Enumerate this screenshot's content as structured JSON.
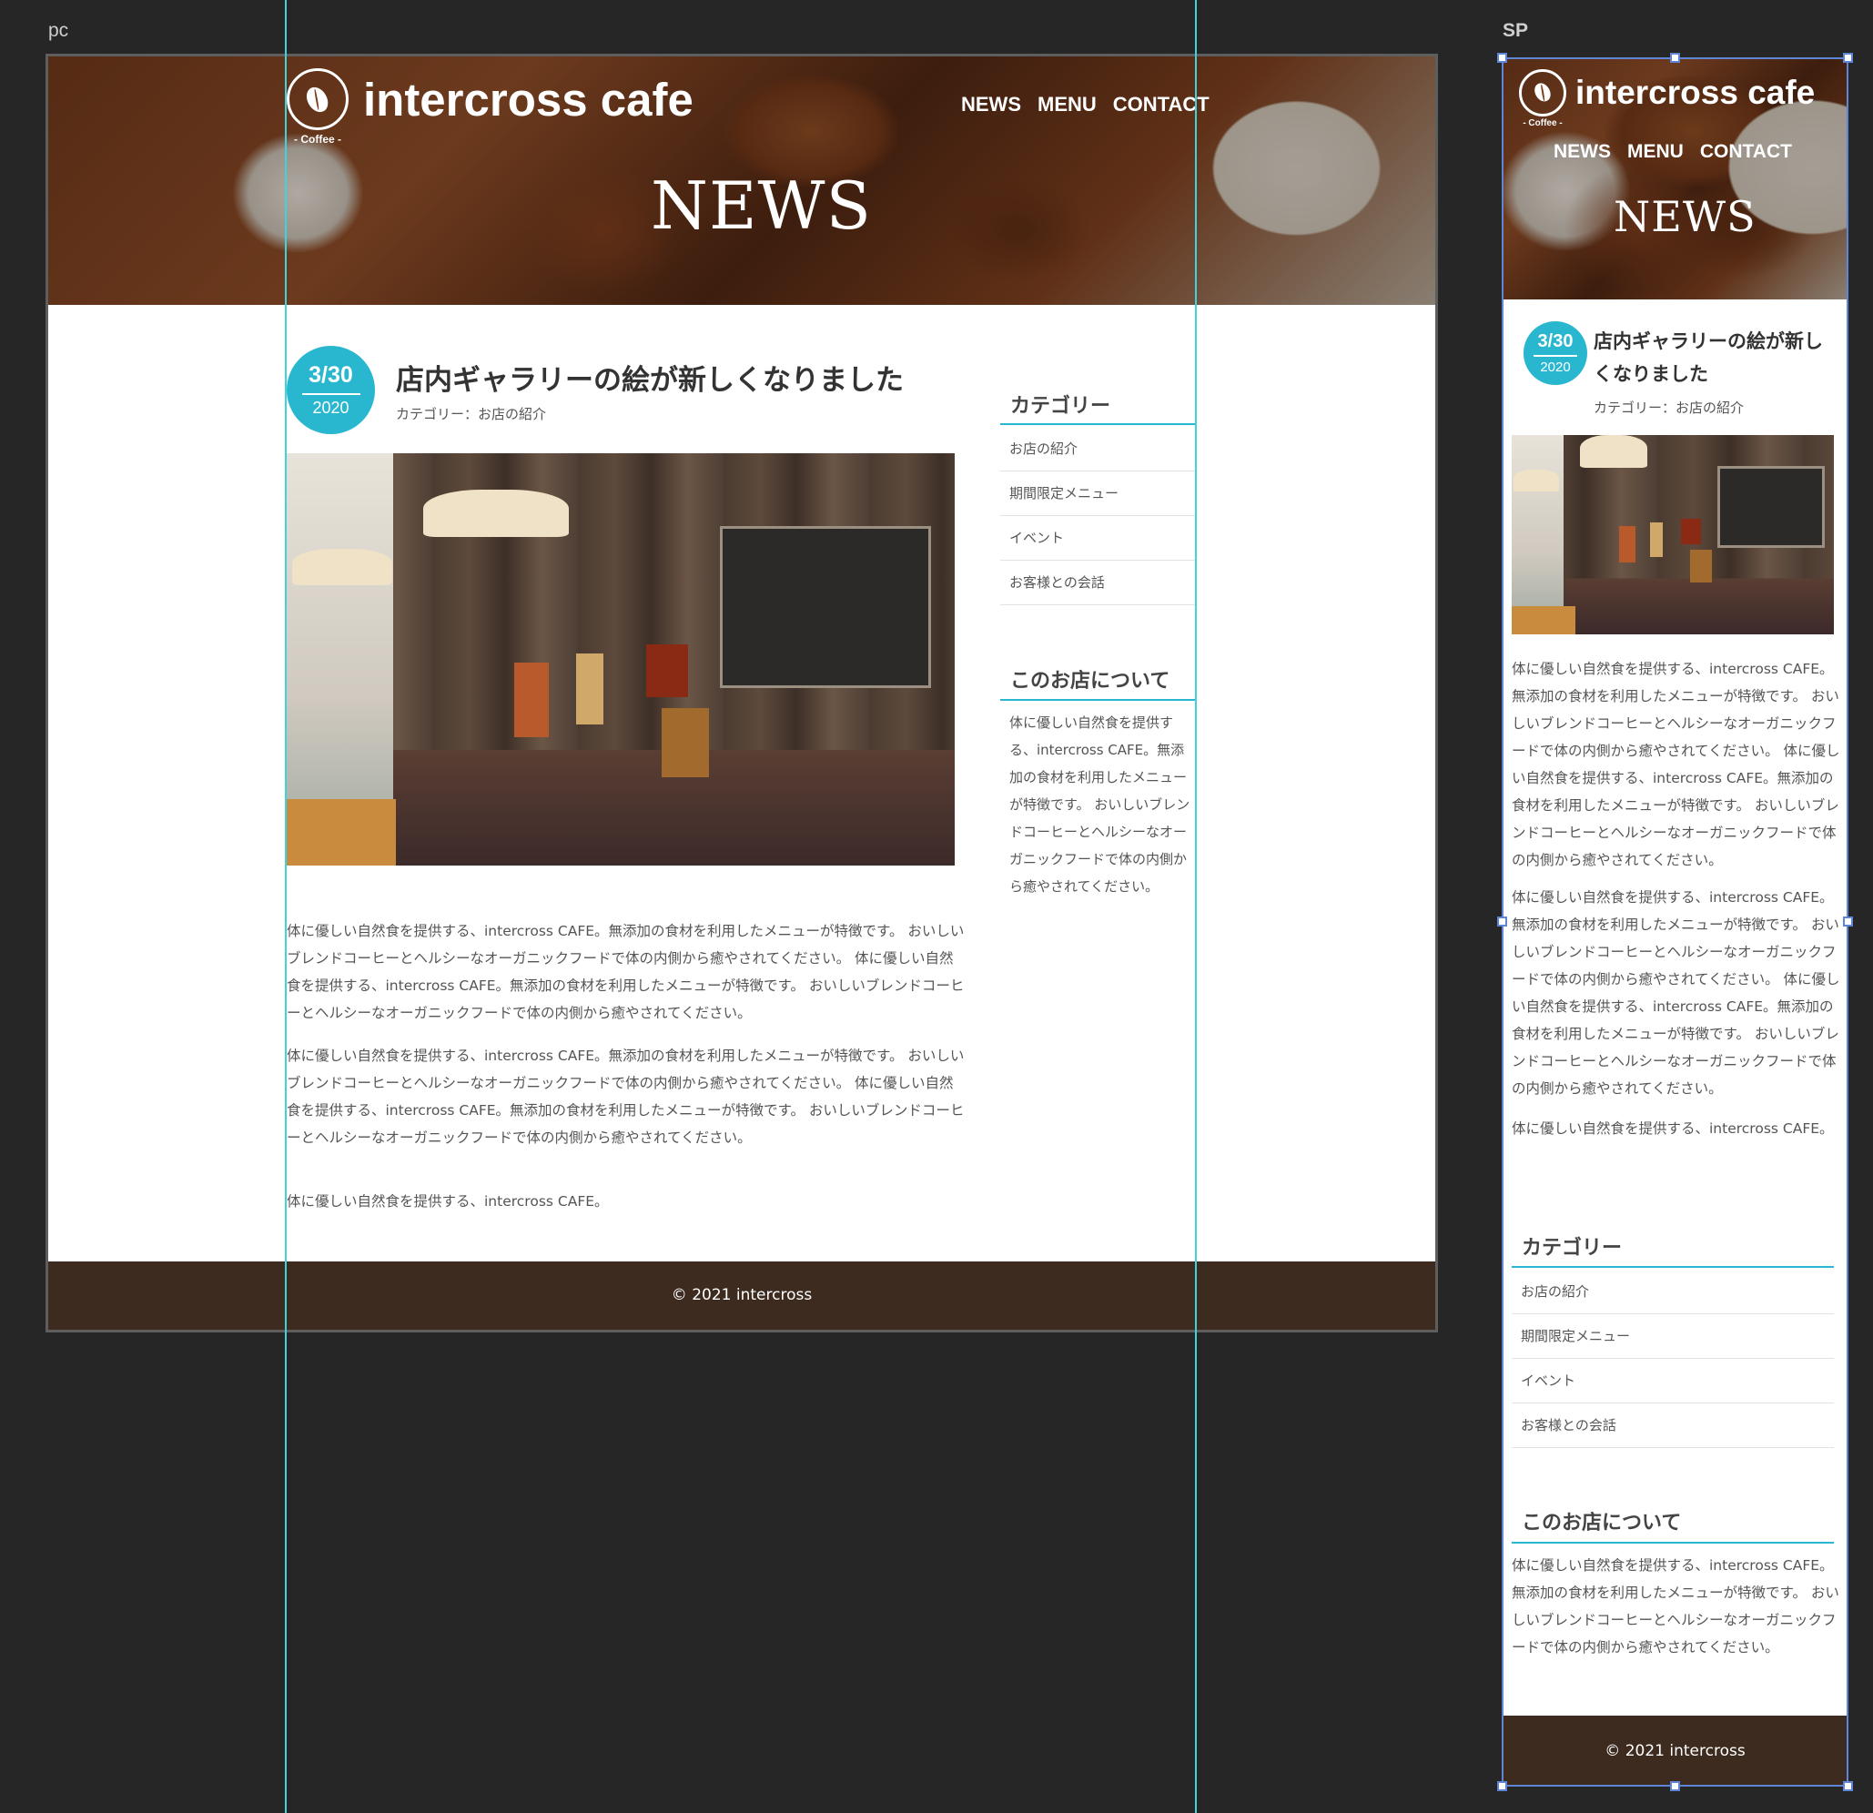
{
  "canvas": {
    "pc_label": "pc",
    "sp_label": "SP"
  },
  "site": {
    "logo_text": "intercross cafe",
    "logo_sub": "- Coffee -",
    "nav": [
      "NEWS",
      "MENU",
      "CONTACT"
    ],
    "hero_title": "NEWS",
    "footer": "© 2021 intercross"
  },
  "post": {
    "date_md": "3/30",
    "date_year": "2020",
    "title": "店内ギャラリーの絵が新しくなりました",
    "category_line": "カテゴリー：お店の紹介",
    "photo_icon": "cafe-interior-photo",
    "paragraphs": [
      "体に優しい自然食を提供する、intercross CAFE。無添加の食材を利用したメニューが特徴です。 おいしいブレンドコーヒーとヘルシーなオーガニックフードで体の内側から癒やされてください。 体に優しい自然食を提供する、intercross CAFE。無添加の食材を利用したメニューが特徴です。 おいしいブレンドコーヒーとヘルシーなオーガニックフードで体の内側から癒やされてください。",
      "体に優しい自然食を提供する、intercross CAFE。無添加の食材を利用したメニューが特徴です。 おいしいブレンドコーヒーとヘルシーなオーガニックフードで体の内側から癒やされてください。 体に優しい自然食を提供する、intercross CAFE。無添加の食材を利用したメニューが特徴です。 おいしいブレンドコーヒーとヘルシーなオーガニックフードで体の内側から癒やされてください。",
      "体に優しい自然食を提供する、intercross CAFE。"
    ]
  },
  "sidebar": {
    "category_heading": "カテゴリー",
    "categories": [
      "お店の紹介",
      "期間限定メニュー",
      "イベント",
      "お客様との会話"
    ],
    "about_heading": "このお店について",
    "about_text": "体に優しい自然食を提供する、intercross CAFE。無添加の食材を利用したメニューが特徴です。 おいしいブレンドコーヒーとヘルシーなオーガニックフードで体の内側から癒やされてください。"
  },
  "colors": {
    "accent": "#28b7cf",
    "footer_bg": "#3e2b20",
    "canvas_bg": "#262626",
    "guide": "#3fd3dd",
    "selection": "#5f86d6"
  }
}
